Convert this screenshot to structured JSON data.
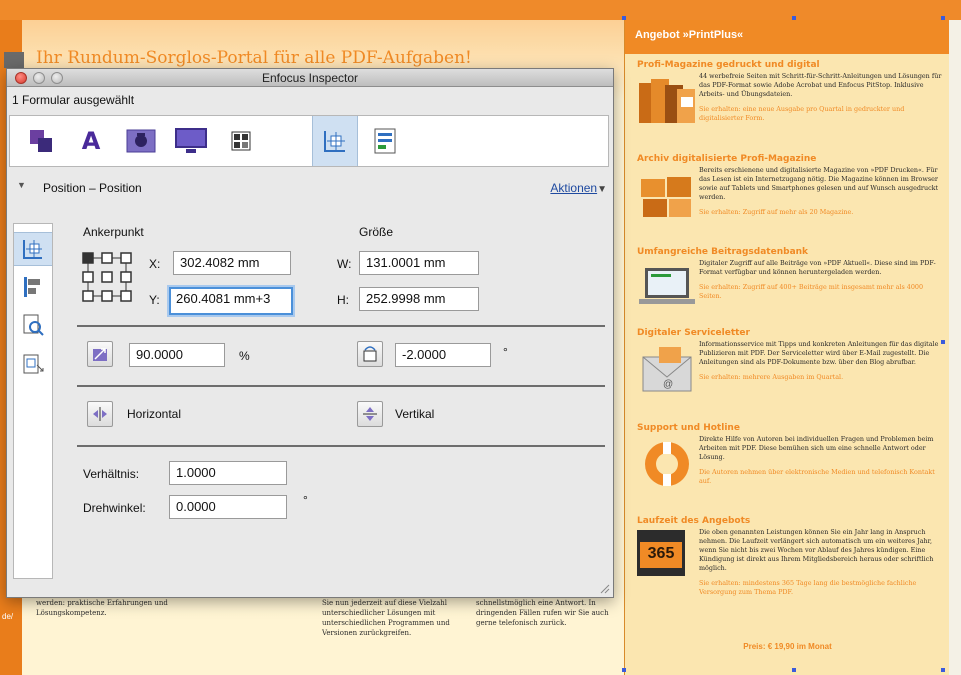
{
  "background_doc": {
    "portal_title": "Ihr Rundum-Sorglos-Portal für alle PDF-Aufgaben!",
    "col1": "werden: praktische Erfahrungen und Lösungskompetenz.",
    "col2": "Sie nun jederzeit auf diese Vielzahl unterschiedlicher Lösungen mit unterschiedlichen Programmen und Versionen zurückgreifen.",
    "col3": "schnellstmöglich eine Antwort. In dringenden Fällen rufen wir Sie auch gerne telefonisch zurück.",
    "side_label": "de/"
  },
  "promo": {
    "header": "Angebot »PrintPlus«",
    "blocks": [
      {
        "title": "Profi-Magazine gedruckt und digital",
        "text": "44 werbefreie Seiten mit Schritt-für-Schritt-Anleitungen und Lösungen für das PDF-Format sowie Adobe Acrobat und Enfocus PitStop. Inklusive Arbeits- und Übungsdateien.",
        "note": "Sie erhalten: eine neue Ausgabe pro Quartal in gedruckter und digitalisierter Form.",
        "icon": "magazine-stack-icon"
      },
      {
        "title": "Archiv digitalisierte Profi-Magazine",
        "text": "Bereits erschienene und digitalisierte Magazine von »PDF Drucken«. Für das Lesen ist ein Internetzugang nötig. Die Magazine können im Browser sowie auf Tablets und Smartphones gelesen und auf Wunsch ausgedruckt werden.",
        "note": "Sie erhalten: Zugriff auf mehr als 20 Magazine.",
        "icon": "archive-boxes-icon"
      },
      {
        "title": "Umfangreiche Beitragsdatenbank",
        "text": "Digitaler Zugriff auf alle Beiträge von »PDF Aktuell«. Diese sind im PDF-Format verfügbar und können heruntergeladen werden.",
        "note": "Sie erhalten: Zugriff auf 400+ Beiträge mit insgesamt mehr als 4000 Seiten.",
        "icon": "laptop-icon"
      },
      {
        "title": "Digitaler Serviceletter",
        "text": "Informationsservice mit Tipps und konkreten Anleitungen für das digitale Publizieren mit PDF. Der Serviceletter wird über E-Mail zugestellt. Die Anleitungen sind als PDF-Dokumente bzw. über den Blog abrufbar.",
        "note": "Sie erhalten: mehrere Ausgaben im Quartal.",
        "icon": "envelope-icon"
      },
      {
        "title": "Support und Hotline",
        "text": "Direkte Hilfe von Autoren bei individuellen Fragen und Problemen beim Arbeiten mit PDF. Diese bemühen sich um eine schnelle Antwort oder Lösung.",
        "note": "Die Autoren nehmen über elektronische Medien und telefonisch Kontakt auf.",
        "icon": "lifebuoy-icon"
      },
      {
        "title": "Laufzeit des Angebots",
        "text": "Die oben genannten Leistungen können Sie ein Jahr lang in Anspruch nehmen. Die Laufzeit verlängert sich automatisch um ein weiteres Jahr, wenn Sie nicht bis zwei Wochen vor Ablauf des Jahres kündigen. Eine Kündigung ist direkt aus Ihrem Mitgliedsbereich heraus oder schriftlich möglich.",
        "note": "Sie erhalten: mindestens 365 Tage lang die bestmögliche fachliche Versorgung zum Thema PDF.",
        "icon": "calendar-365-icon",
        "icon_text": "365"
      }
    ],
    "price": "Preis: € 19,90 im Monat"
  },
  "inspector": {
    "title": "Enfocus Inspector",
    "status": "1 Formular ausgewählt",
    "toolbar": [
      "layers-icon",
      "text-icon",
      "image-icon",
      "monitor-icon",
      "grid-icon",
      "position-icon",
      "form-icon"
    ],
    "toolbar_active": "position-icon",
    "section": {
      "label": "Position – Position",
      "actions": "Aktionen"
    },
    "side_tabs": [
      "position-icon",
      "align-icon",
      "zoom-page-icon",
      "page-box-icon"
    ],
    "anchor_label": "Ankerpunkt",
    "size_label": "Größe",
    "x_label": "X:",
    "x_value": "302.4082 mm",
    "y_label": "Y:",
    "y_value": "260.4081 mm+3",
    "w_label": "W:",
    "w_value": "131.0001 mm",
    "h_label": "H:",
    "h_value": "252.9998 mm",
    "scale_value": "90.0000",
    "scale_unit": "%",
    "rotate_value": "-2.0000",
    "rotate_unit": "°",
    "flip_h": "Horizontal",
    "flip_v": "Vertikal",
    "ratio_label": "Verhältnis:",
    "ratio_value": "1.0000",
    "angle_label": "Drehwinkel:",
    "angle_value": "0.0000",
    "angle_unit": "°"
  },
  "colors": {
    "accent": "#f08a25",
    "selection": "#cfe0f2",
    "focus": "#4b90d9"
  }
}
